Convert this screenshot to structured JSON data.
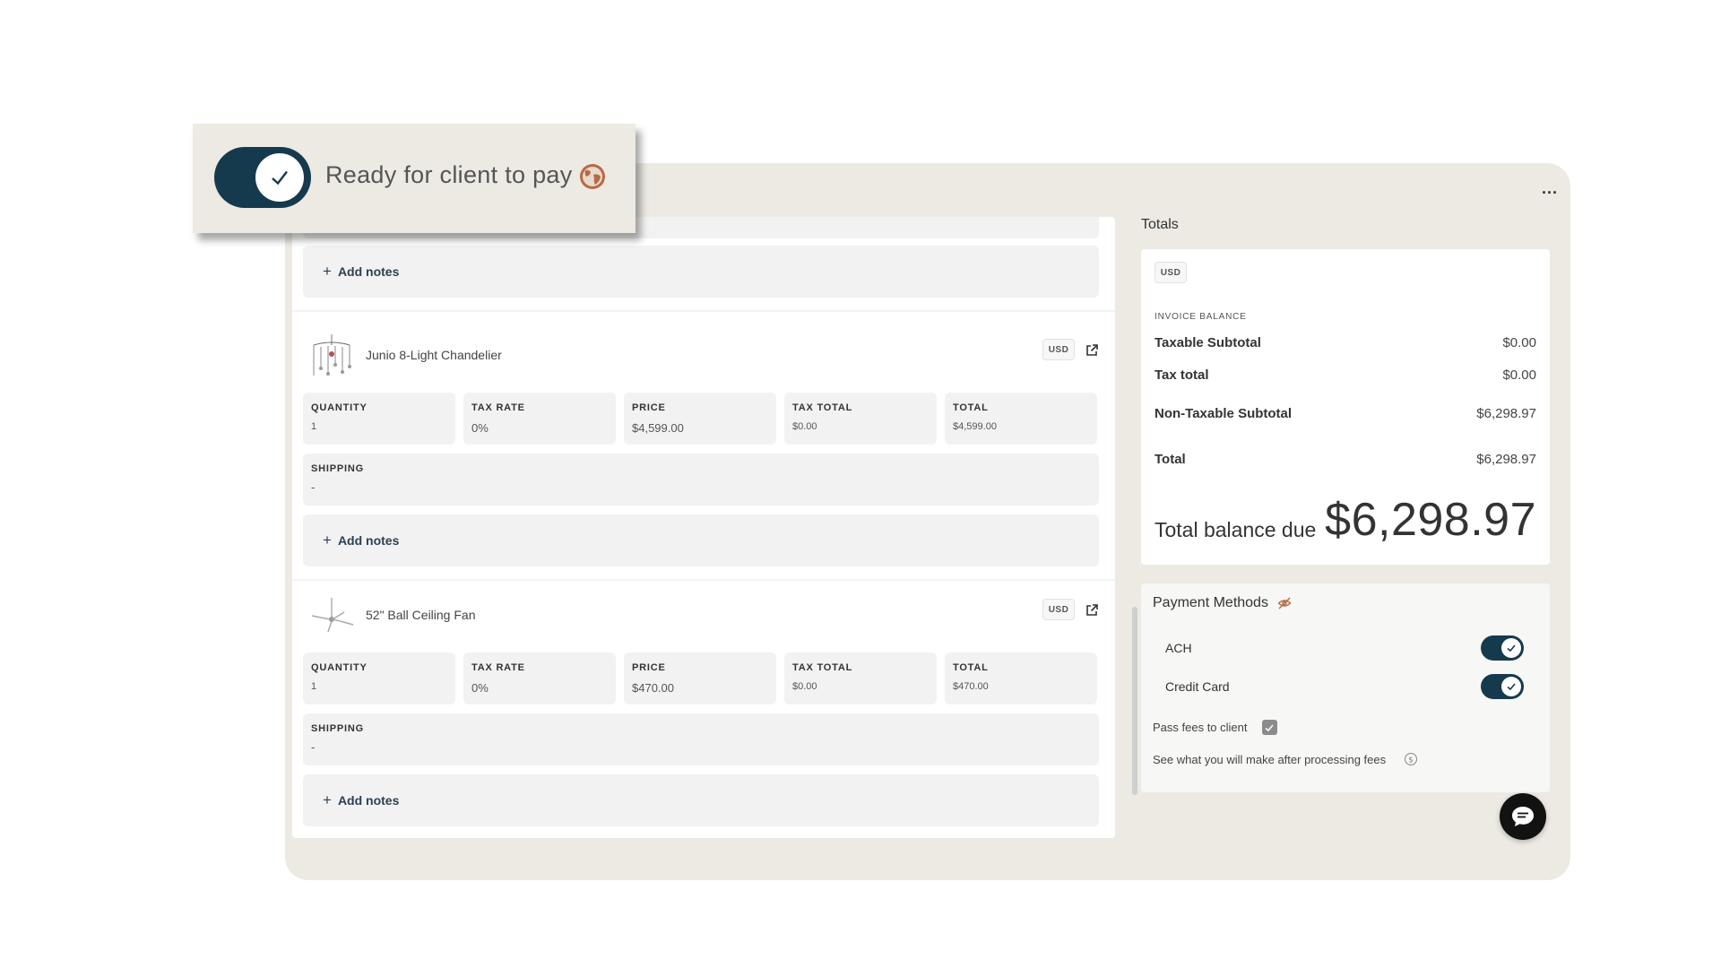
{
  "panel": {
    "menu_label": "..."
  },
  "callout": {
    "label": "Ready for client to pay",
    "toggle_on": true
  },
  "line_items": {
    "first_add_notes": "Add notes",
    "items": [
      {
        "name": "Junio 8-Light Chandelier",
        "currency": "USD",
        "fields": [
          {
            "label": "QUANTITY",
            "value": "1"
          },
          {
            "label": "TAX RATE",
            "value": "0%"
          },
          {
            "label": "PRICE",
            "value": "$4,599.00"
          },
          {
            "label": "TAX TOTAL",
            "value": "$0.00"
          },
          {
            "label": "TOTAL",
            "value": "$4,599.00"
          }
        ],
        "shipping_label": "SHIPPING",
        "shipping_value": "-",
        "add_notes": "Add notes"
      },
      {
        "name": "52\" Ball Ceiling Fan",
        "currency": "USD",
        "fields": [
          {
            "label": "QUANTITY",
            "value": "1"
          },
          {
            "label": "TAX RATE",
            "value": "0%"
          },
          {
            "label": "PRICE",
            "value": "$470.00"
          },
          {
            "label": "TAX TOTAL",
            "value": "$0.00"
          },
          {
            "label": "TOTAL",
            "value": "$470.00"
          }
        ],
        "shipping_label": "SHIPPING",
        "shipping_value": "-",
        "add_notes": "Add notes"
      }
    ]
  },
  "totals": {
    "title": "Totals",
    "currency": "USD",
    "section_label": "INVOICE BALANCE",
    "rows": [
      {
        "label": "Taxable Subtotal",
        "value": "$0.00"
      },
      {
        "label": "Tax total",
        "value": "$0.00"
      },
      {
        "label": "Non-Taxable Subtotal",
        "value": "$6,298.97"
      },
      {
        "label": "Total",
        "value": "$6,298.97"
      }
    ],
    "balance_due_label": "Total balance due",
    "balance_due_value": "$6,298.97"
  },
  "payment_methods": {
    "title": "Payment Methods",
    "methods": [
      {
        "label": "ACH",
        "enabled": true
      },
      {
        "label": "Credit Card",
        "enabled": true
      }
    ],
    "pass_fees_label": "Pass fees to client",
    "pass_fees_checked": true,
    "see_fees_label": "See what you will make after processing fees"
  },
  "colors": {
    "panel_bg": "#eceae3",
    "toggle_on": "#163a4d",
    "globe": "#b76a45"
  }
}
